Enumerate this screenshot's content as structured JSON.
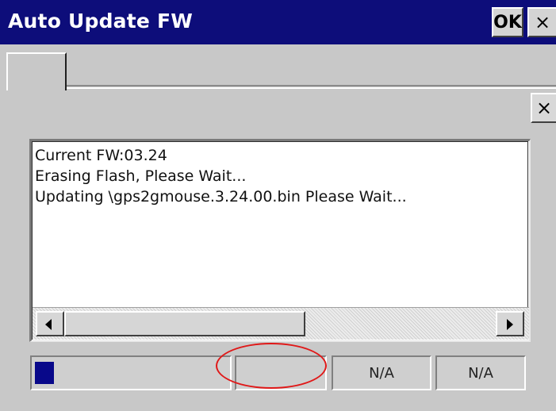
{
  "window": {
    "title": "Auto Update FW",
    "ok_label": "OK",
    "close_glyph": "×"
  },
  "panel": {
    "close_glyph": "×"
  },
  "log": {
    "lines": [
      "Current FW:03.24",
      "Erasing Flash, Please Wait...",
      "Updating \\gps2gmouse.3.24.00.bin Please Wait..."
    ]
  },
  "status": {
    "progress_fraction": 0.1,
    "empty_cell_text": "",
    "cell3_text": "N/A",
    "cell4_text": "N/A"
  },
  "icons": {
    "scroll_left": "triangle-left-icon",
    "scroll_right": "triangle-right-icon"
  },
  "colors": {
    "titlebar": "#0d0d7a",
    "progress_fill": "#08088a",
    "highlight_ring": "#e01818"
  }
}
